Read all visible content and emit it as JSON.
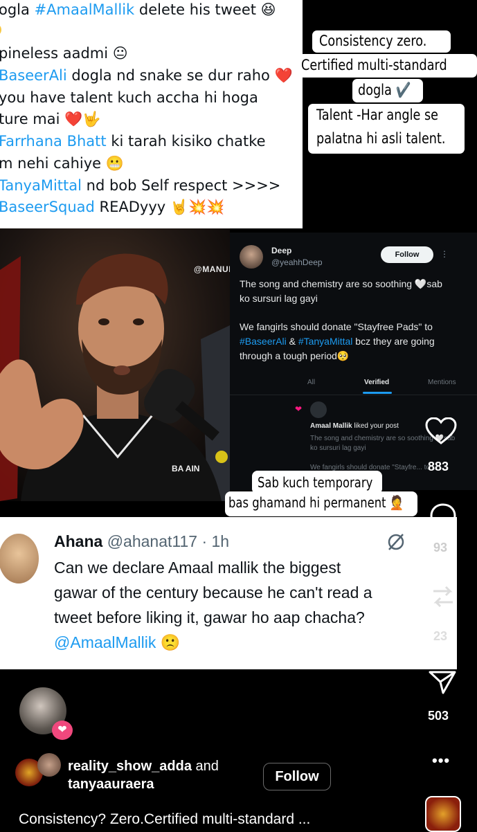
{
  "top_tweet": {
    "lines": [
      {
        "pre": "ogla ",
        "tag": "#AmaalMallik",
        "post": " delete his tweet 😆"
      },
      {
        "pre": "",
        "tag": "",
        "post": "pineless aadmi 😐"
      },
      {
        "pre": "",
        "tag": "BaseerAli",
        "post": " dogla nd snake se dur raho ❤️"
      },
      {
        "pre": "",
        "tag": "",
        "post": "you have talent kuch accha hi hoga"
      },
      {
        "pre": "",
        "tag": "",
        "post": "ture mai ❤️🤟"
      },
      {
        "pre": "",
        "tag": "Farrhana Bhatt",
        "post": " ki tarah kisiko chatke"
      },
      {
        "pre": "",
        "tag": "",
        "post": "m nehi cahiye 😬"
      },
      {
        "pre": "",
        "tag": "TanyaMittal",
        "post": " nd bob Self respect >>>>"
      },
      {
        "pre": "",
        "tag": "BaseerSquad",
        "post": " READyyy 🤘💥💥"
      }
    ]
  },
  "sticker_top": {
    "lines": [
      "Consistency zero.",
      "Certified multi-standard",
      "dogla ✔️",
      "Talent -Har angle se",
      "palatna hi asli talent."
    ]
  },
  "video": {
    "watermark": "@MANUP",
    "shirt_text": "BA AIN"
  },
  "dark_tweet": {
    "name": "Deep",
    "handle": "@yeahhDeep",
    "follow": "Follow",
    "text1": "The song and chemistry are so soothing 🤍sab ko sursuri lag gayi",
    "text2_pre": "We fangirls should donate \"Stayfree Pads\" to ",
    "tag1": "#BaseerAli",
    "amp": " & ",
    "tag2": "#TanyaMittal",
    "text2_post": " bcz they are going through a tough period🥺",
    "tabs": [
      "All",
      "Verified",
      "Mentions"
    ],
    "notif_title_strong": "Amaal Mallik",
    "notif_title_rest": " liked your post",
    "notif_line1": "The song and chemistry are so soothing 🤍sab",
    "notif_line2": "ko sursuri lag gayi",
    "notif_line3": "We fangirls should donate \"Stayfre... to ..."
  },
  "sticker_mid": {
    "line1": "Sab kuch temporary",
    "line2": "bas ghamand hi permanent 🤦"
  },
  "ahana_tweet": {
    "name": "Ahana",
    "meta": "@ahanat117 · 1h",
    "text1": "Can we declare Amaal mallik the biggest",
    "text2": "gawar of the century because he can't read a",
    "text3": "tweet before liking it, gawar ho aap chacha?",
    "mention": "@AmaalMallik",
    "emoji": "🙁"
  },
  "side": {
    "like_count": "883",
    "comment_count": "93",
    "repost_count": "23",
    "share_count": "503"
  },
  "footer": {
    "accounts_a": "reality_show_adda",
    "and": " and",
    "accounts_b": "tanyaauraera",
    "follow": "Follow",
    "caption": "Consistency? Zero.Certified multi-standard ..."
  },
  "colors": {
    "link": "#1d9bf0",
    "heart": "#ff3040",
    "dark_card": "#0b0d10"
  }
}
